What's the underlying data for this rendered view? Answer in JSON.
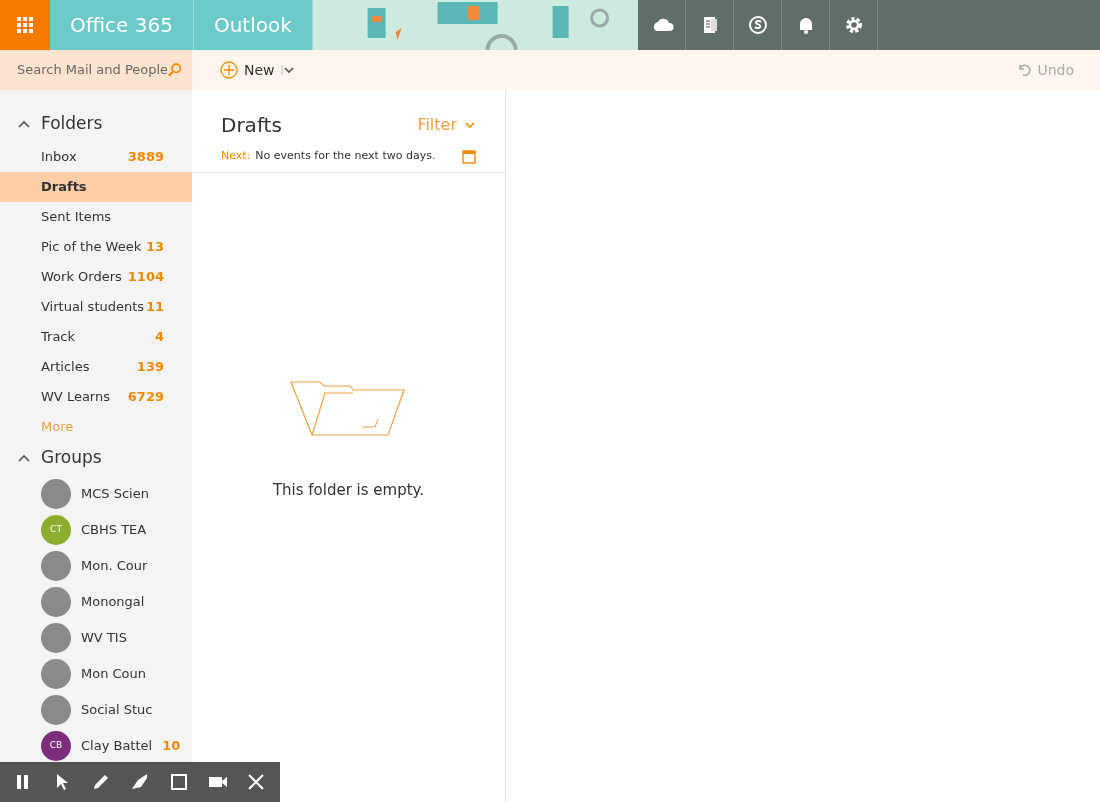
{
  "header": {
    "app_suite": "Office 365",
    "app_name": "Outlook"
  },
  "toolbar": {
    "search": {
      "placeholder": "Search Mail and People"
    },
    "new_label": "New",
    "undo_label": "Undo",
    "undo_disabled": true
  },
  "folders": {
    "title": "Folders",
    "expanded": true,
    "items": [
      {
        "name": "Inbox",
        "count": "3889",
        "selected": false
      },
      {
        "name": "Drafts",
        "selected": true
      },
      {
        "name": "Sent Items",
        "selected": false
      },
      {
        "name": "Pic of the Week",
        "count": "13",
        "selected": false
      },
      {
        "name": "Work Orders",
        "count": "1104",
        "selected": false
      },
      {
        "name": "Virtual students",
        "count": "11",
        "selected": false
      },
      {
        "name": "Track",
        "count": "4",
        "selected": false
      },
      {
        "name": "Articles",
        "count": "139",
        "selected": false
      },
      {
        "name": "WV Learns",
        "count": "6729",
        "selected": false
      }
    ],
    "more_label": "More"
  },
  "groups": {
    "title": "Groups",
    "expanded": true,
    "items": [
      {
        "name": "MCS Scien",
        "kind": "photo"
      },
      {
        "name": "CBHS TEA",
        "kind": "initials",
        "initials": "CT",
        "color": "#8cad2e"
      },
      {
        "name": "Mon. Cour",
        "kind": "photo"
      },
      {
        "name": "Monongal",
        "kind": "photo"
      },
      {
        "name": "WV TIS",
        "kind": "photo"
      },
      {
        "name": "Mon Coun",
        "kind": "photo"
      },
      {
        "name": "Social Stuc",
        "kind": "photo"
      },
      {
        "name": "Clay Battel",
        "kind": "initials",
        "initials": "CB",
        "color": "#7b2f7a",
        "count": "10"
      }
    ]
  },
  "list": {
    "title": "Drafts",
    "filter_label": "Filter",
    "next_label": "Next:",
    "next_text": "No events for the next two days.",
    "empty_text": "This folder is empty."
  }
}
